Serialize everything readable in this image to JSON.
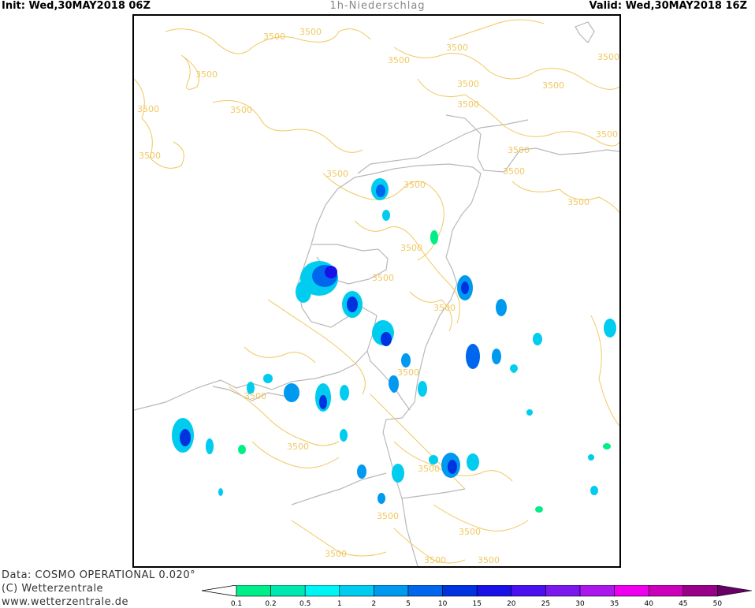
{
  "header": {
    "init": "Init: Wed,30MAY2018 06Z",
    "title": "1h-Niederschlag",
    "valid": "Valid: Wed,30MAY2018 16Z"
  },
  "footer": {
    "data_line": "Data: COSMO OPERATIONAL 0.020°",
    "copyright": "(C) Wetterzentrale",
    "url": "www.wetterzentrale.de"
  },
  "contour_label": "3500",
  "legend": {
    "levels": [
      "0.1",
      "0.2",
      "0.5",
      "1",
      "2",
      "5",
      "10",
      "15",
      "20",
      "25",
      "30",
      "35",
      "40",
      "45",
      "50"
    ],
    "colors": [
      "#00ee88",
      "#00e8b0",
      "#00f4f4",
      "#00ccf0",
      "#0099f0",
      "#0066ee",
      "#0033e0",
      "#1a10e8",
      "#4a10ee",
      "#7a18ee",
      "#aa18ee",
      "#ee00ee",
      "#cc00bb",
      "#990088",
      "#660066"
    ],
    "under_color": "#ffffff"
  },
  "colors": {
    "contour": "#f0c860",
    "border": "#b8b8b8"
  }
}
